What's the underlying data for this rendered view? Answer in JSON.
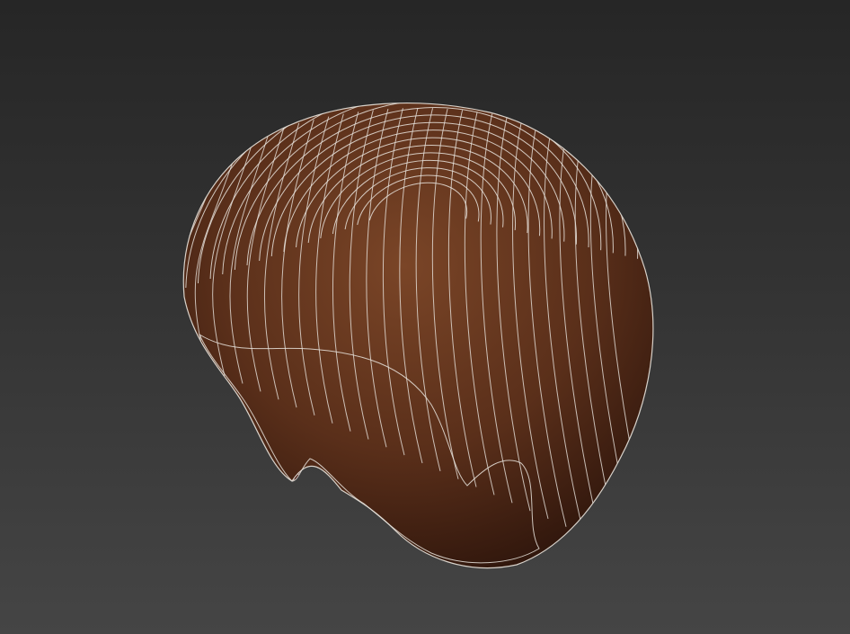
{
  "viewport": {
    "background_top": "#262626",
    "background_bottom": "#454545"
  },
  "model": {
    "kind": "hair-cap-mesh",
    "surface_color": "#5a2f1a",
    "surface_highlight": "#7a4527",
    "surface_shadow": "#2c140b",
    "inner_color": "#3e120c",
    "wire_color": "#e9e4dd",
    "wireframe_visible": true
  }
}
